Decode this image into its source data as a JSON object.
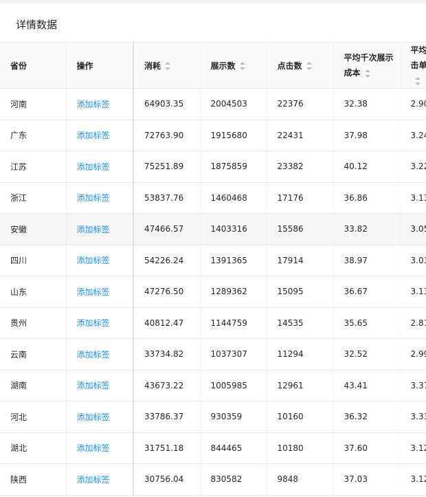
{
  "card": {
    "title": "详情数据"
  },
  "table": {
    "columns": [
      "省份",
      "操作",
      "消耗",
      "展示数",
      "点击数",
      "平均千次展示成本",
      "平均点击单价"
    ],
    "rows": [
      {
        "province": "河南",
        "action": "添加标签",
        "cost": "64903.35",
        "impressions": "2004503",
        "clicks": "22376",
        "cpm": "32.38",
        "cpc": "2.90"
      },
      {
        "province": "广东",
        "action": "添加标签",
        "cost": "72763.90",
        "impressions": "1915680",
        "clicks": "22431",
        "cpm": "37.98",
        "cpc": "3.24"
      },
      {
        "province": "江苏",
        "action": "添加标签",
        "cost": "75251.89",
        "impressions": "1875859",
        "clicks": "23382",
        "cpm": "40.12",
        "cpc": "3.22"
      },
      {
        "province": "浙江",
        "action": "添加标签",
        "cost": "53837.76",
        "impressions": "1460468",
        "clicks": "17176",
        "cpm": "36.86",
        "cpc": "3.13"
      },
      {
        "province": "安徽",
        "action": "添加标签",
        "cost": "47466.57",
        "impressions": "1403316",
        "clicks": "15586",
        "cpm": "33.82",
        "cpc": "3.05"
      },
      {
        "province": "四川",
        "action": "添加标签",
        "cost": "54226.24",
        "impressions": "1391365",
        "clicks": "17914",
        "cpm": "38.97",
        "cpc": "3.03"
      },
      {
        "province": "山东",
        "action": "添加标签",
        "cost": "47276.50",
        "impressions": "1289362",
        "clicks": "15095",
        "cpm": "36.67",
        "cpc": "3.13"
      },
      {
        "province": "贵州",
        "action": "添加标签",
        "cost": "40812.47",
        "impressions": "1144759",
        "clicks": "14535",
        "cpm": "35.65",
        "cpc": "2.81"
      },
      {
        "province": "云南",
        "action": "添加标签",
        "cost": "33734.82",
        "impressions": "1037307",
        "clicks": "11294",
        "cpm": "32.52",
        "cpc": "2.99"
      },
      {
        "province": "湖南",
        "action": "添加标签",
        "cost": "43673.22",
        "impressions": "1005985",
        "clicks": "12961",
        "cpm": "43.41",
        "cpc": "3.37"
      },
      {
        "province": "河北",
        "action": "添加标签",
        "cost": "33786.37",
        "impressions": "930359",
        "clicks": "10160",
        "cpm": "36.32",
        "cpc": "3.33"
      },
      {
        "province": "湖北",
        "action": "添加标签",
        "cost": "31751.18",
        "impressions": "844465",
        "clicks": "10180",
        "cpm": "37.60",
        "cpc": "3.12"
      },
      {
        "province": "陕西",
        "action": "添加标签",
        "cost": "30756.04",
        "impressions": "830582",
        "clicks": "9848",
        "cpm": "37.03",
        "cpc": "3.12"
      }
    ],
    "highlighted_row": 4
  },
  "colors": {
    "link": "#1890ff",
    "header_bg": "#fafafa",
    "hover_row": "#f5f5f5",
    "border": "#e8e8e8"
  }
}
